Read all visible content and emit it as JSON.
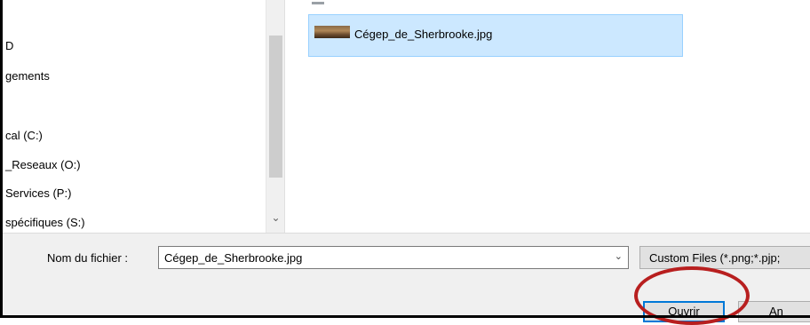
{
  "nav": {
    "items": [
      {
        "label": "D"
      },
      {
        "label": "gements"
      },
      {
        "label": "cal (C:)"
      },
      {
        "label": "_Reseaux (O:)"
      },
      {
        "label": "Services (P:)"
      },
      {
        "label": "spécifiques (S:)"
      }
    ],
    "scroll_down_icon": "chevron-down-icon"
  },
  "files": {
    "selected": {
      "name": "Cégep_de_Sherbrooke.jpg",
      "icon": "image-thumbnail-icon"
    }
  },
  "bottom": {
    "filename_label": "Nom du fichier :",
    "filename_value": "Cégep_de_Sherbrooke.jpg",
    "filter_value": "Custom Files (*.png;*.pjp;",
    "open_button": "Ouvrir",
    "cancel_button": "An"
  },
  "colors": {
    "selection_bg": "#cce8ff",
    "selection_border": "#99d1ff",
    "open_button_border": "#0078d7",
    "annotation_ring": "#b81f1f"
  }
}
